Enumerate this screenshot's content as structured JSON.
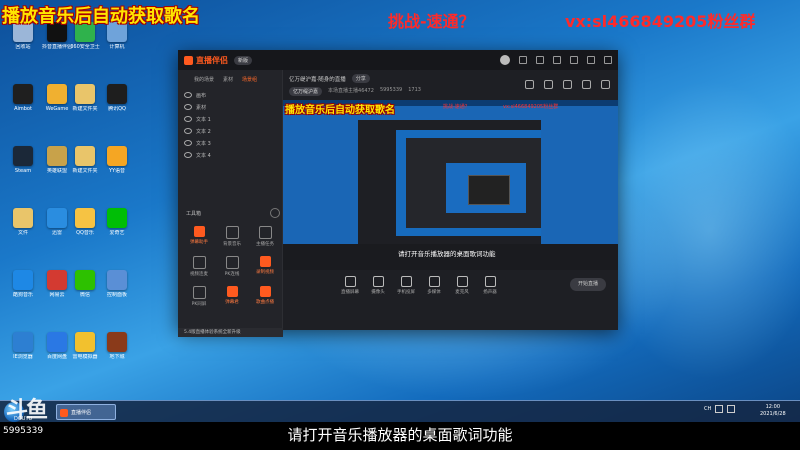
{
  "overlay": {
    "title_left": "播放音乐后自动获取歌名",
    "title_mid": "挑战-速通？",
    "title_right": "vx:sl466849205粉丝群"
  },
  "desktop_icons": [
    {
      "label": "回收站",
      "color": "#9bb6d8"
    },
    {
      "label": "抖音直播伴侣",
      "color": "#111111"
    },
    {
      "label": "360安全卫士",
      "color": "#2fb24c"
    },
    {
      "label": "计算机",
      "color": "#6fa3da"
    },
    {
      "label": "Aimbot",
      "color": "#1f1f1f"
    },
    {
      "label": "WeGame",
      "color": "#f0b030"
    },
    {
      "label": "新建文件夹",
      "color": "#e9c56a"
    },
    {
      "label": "腾讯QQ",
      "color": "#1e1e1e"
    },
    {
      "label": "Steam",
      "color": "#1b2838"
    },
    {
      "label": "英雄联盟",
      "color": "#c8a24a"
    },
    {
      "label": "新建文件夹",
      "color": "#e9c56a"
    },
    {
      "label": "YY语音",
      "color": "#f5a623"
    },
    {
      "label": "文件",
      "color": "#e9c56a"
    },
    {
      "label": "迅雷",
      "color": "#2a8de0"
    },
    {
      "label": "QQ音乐",
      "color": "#f6c343"
    },
    {
      "label": "爱奇艺",
      "color": "#00be06"
    },
    {
      "label": "酷狗音乐",
      "color": "#1e88e5"
    },
    {
      "label": "网易云",
      "color": "#d33a31"
    },
    {
      "label": "微信",
      "color": "#2dc100"
    },
    {
      "label": "控制面板",
      "color": "#5a8fd6"
    },
    {
      "label": "IE浏览器",
      "color": "#2d7fd2"
    },
    {
      "label": "百度网盘",
      "color": "#2a78e4"
    },
    {
      "label": "雷电模拟器",
      "color": "#f2c12e"
    },
    {
      "label": "地下城",
      "color": "#8a3a1a"
    }
  ],
  "app": {
    "logo_text": "直播伴侣",
    "badge": "新版",
    "left_tabs": [
      "我的场景",
      "素材",
      "场景组"
    ],
    "scenes": [
      "画布",
      "素材",
      "文本 1",
      "文本 2",
      "文本 3",
      "文本 4"
    ],
    "tools_title": "工具箱",
    "tools": [
      {
        "label": "弹幕助手",
        "style": "red"
      },
      {
        "label": "背景音乐",
        "style": "grey"
      },
      {
        "label": "主播任务",
        "style": "grey"
      },
      {
        "label": "视频连麦",
        "style": "grey"
      },
      {
        "label": "PK连线",
        "style": "grey"
      },
      {
        "label": "录制视频",
        "style": "red"
      },
      {
        "label": "PK同屏",
        "style": "grey"
      },
      {
        "label": "弹幕君",
        "style": "red"
      },
      {
        "label": "歌曲点播",
        "style": "red"
      }
    ],
    "room_title": "亿万缇沪嘉·随身的直播",
    "room_tag": "分享",
    "room_stats": [
      "亿万缇沪嘉",
      "本场直播主播46472",
      "5995339",
      "1713"
    ],
    "preview_title": "播放音乐后自动获取歌名",
    "preview_mid": "挑战-速通？",
    "preview_right": "vx:sl466849205粉丝群",
    "preview_caption": "请打开音乐播放器的桌面歌词功能",
    "controls": [
      "直播屏幕",
      "摄像头",
      "手机投屏",
      "多媒体",
      "麦克风",
      "扬声器"
    ],
    "start_button": "开始直播",
    "notice": "5.4版直播体验系统全新升级"
  },
  "taskbar": {
    "app_label": "直播伴侣",
    "tray_lang": "CH",
    "time": "12:00",
    "date": "2021/6/28"
  },
  "watermark": {
    "logo": "斗鱼",
    "sub": "DOUYU",
    "room_id": "5995339"
  },
  "subtitle": "请打开音乐播放器的桌面歌词功能"
}
